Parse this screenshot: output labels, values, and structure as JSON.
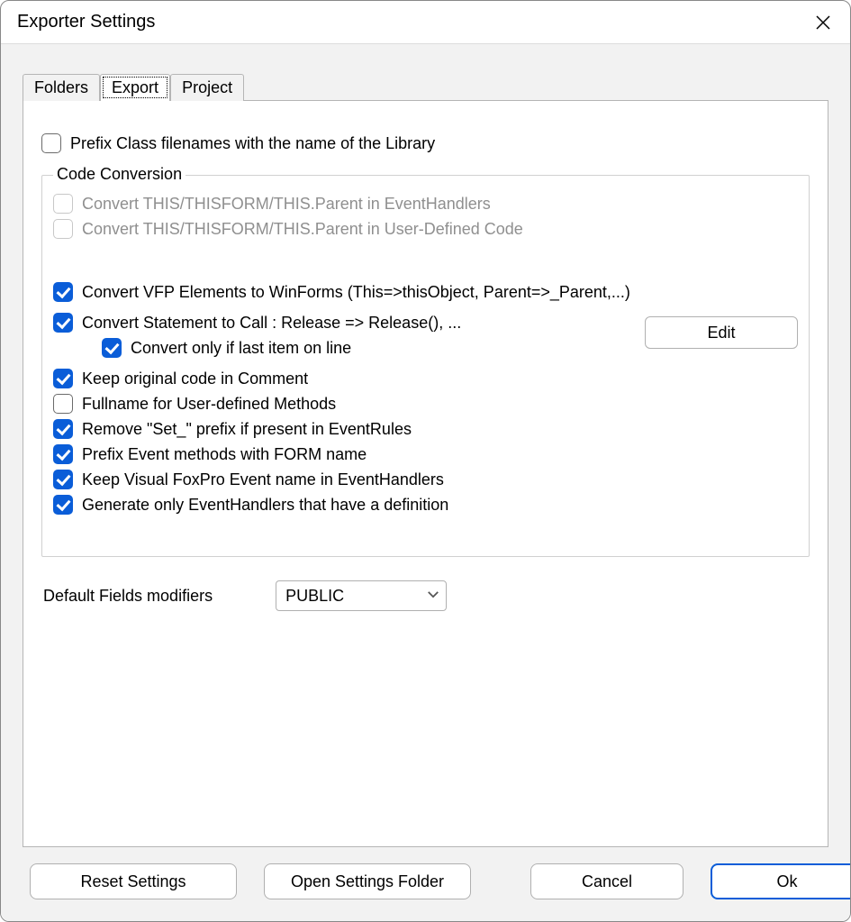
{
  "window": {
    "title": "Exporter Settings"
  },
  "tabs": {
    "folders": "Folders",
    "export": "Export",
    "project": "Project",
    "active": "export"
  },
  "export": {
    "prefix_class_filenames": {
      "label": "Prefix Class filenames with the name of the Library",
      "checked": false
    },
    "code_conversion": {
      "legend": "Code Conversion",
      "convert_this_event": {
        "label": "Convert THIS/THISFORM/THIS.Parent in EventHandlers",
        "checked": false,
        "disabled": true
      },
      "convert_this_user": {
        "label": "Convert THIS/THISFORM/THIS.Parent in User-Defined Code",
        "checked": false,
        "disabled": true
      },
      "convert_vfp_elements": {
        "label": "Convert VFP Elements to WinForms (This=>thisObject, Parent=>_Parent,...)",
        "checked": true
      },
      "convert_statement_call": {
        "label": "Convert Statement to Call : Release => Release(), ...",
        "checked": true
      },
      "convert_only_last_item": {
        "label": "Convert only if last item on line",
        "checked": true
      },
      "edit_button": "Edit",
      "keep_original_comment": {
        "label": "Keep original code in Comment",
        "checked": true
      },
      "fullname_user_methods": {
        "label": "Fullname for User-defined Methods",
        "checked": false
      },
      "remove_set_prefix": {
        "label": "Remove \"Set_\" prefix if present in EventRules",
        "checked": true
      },
      "prefix_event_methods": {
        "label": "Prefix Event methods with FORM name",
        "checked": true
      },
      "keep_vfp_event_name": {
        "label": "Keep Visual FoxPro Event name in EventHandlers",
        "checked": true
      },
      "generate_only_eventhandlers": {
        "label": "Generate only EventHandlers that have a definition",
        "checked": true
      }
    },
    "default_fields_modifiers": {
      "label": "Default Fields modifiers",
      "value": "PUBLIC"
    }
  },
  "buttons": {
    "reset": "Reset Settings",
    "open_folder": "Open Settings Folder",
    "cancel": "Cancel",
    "ok": "Ok"
  }
}
